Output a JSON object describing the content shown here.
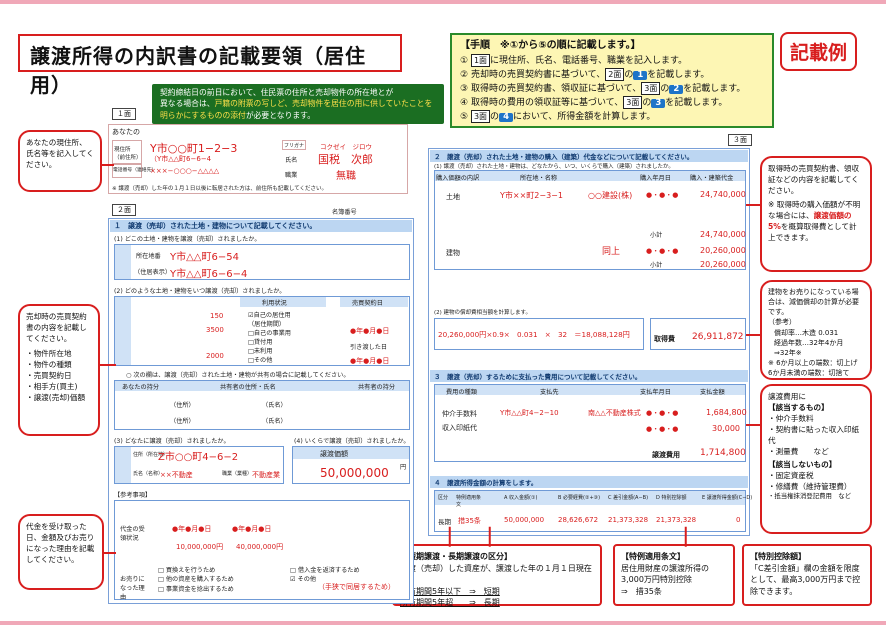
{
  "header": {
    "title": "譲渡所得の内訳書の記載要領（居住用）",
    "example_label": "記載例"
  },
  "steps": {
    "title": "【手順　※①から⑤の順に記載します。】",
    "items": [
      {
        "num": "①",
        "pre": "",
        "page": "1面",
        "post": "に現住所、氏名、電話番号、職業を記入します。"
      },
      {
        "num": "②",
        "pre": "売却時の売買契約書に基づいて、",
        "page": "2面",
        "badge": "1",
        "post": "を記載します。"
      },
      {
        "num": "③",
        "pre": "取得時の売買契約書、領収証に基づいて、",
        "page": "3面",
        "badge": "2",
        "post": "を記載します。"
      },
      {
        "num": "④",
        "pre": "取得時の費用の領収証等に基づいて、",
        "page": "3面",
        "badge": "3",
        "post": "を記載します。"
      },
      {
        "num": "⑤",
        "pre": "",
        "page": "3面",
        "badge": "4",
        "post": "において、所得金額を計算します。"
      }
    ]
  },
  "green_note": {
    "line1": "契約締結日の前日において、住民票の住所と売却物件の所在地とが",
    "line2_pre": "異なる場合は、",
    "line2_red": "戸籍の附票の写しど、売却物件を居住の用に供していたことを明らかにするものの添付",
    "line2_post": "が必要となります。"
  },
  "notes": {
    "address": "あなたの現住所、氏名等を記入してください。",
    "sale_contract": "売却時の売買契約書の内容を記載してください。",
    "sale_items": [
      "物件所在地",
      "物件の種類",
      "売買契約日",
      "相手方(買主)",
      "譲渡(売却)価額"
    ],
    "payment": "代金を受け取った日、金額及びお売りになった理由を記載してください。",
    "purchase": "取得時の売買契約書、領収証などの内容を記載してください。",
    "purchase_warn_pre": "※ 取得時の購入価額が不明な場合には、",
    "purchase_warn_red": "譲渡価額の5%",
    "purchase_warn_post": "を概算取得費として計上できます。",
    "depreciation": "建物をお売りになっている場合は、減価償却の計算が必要です。",
    "depreciation_ref": "（参考）",
    "depreciation_rates": [
      "償却率…木造 0.031",
      "経過年数…32年4か月",
      "⇒32年※"
    ],
    "depreciation_footnote": "※ 6か月以上の端数：切上げ 6か月未満の端数：切捨て",
    "expense_title": "譲渡費用に",
    "expense_in_title": "【該当するもの】",
    "expense_in": [
      "仲介手数料",
      "契約書に貼った収入印紙代",
      "測量費　　など"
    ],
    "expense_out_title": "【該当しないもの】",
    "expense_out": [
      "固定資産税",
      "修繕費（維持管理費）",
      "抵当権抹消登記費用　など"
    ]
  },
  "bottom_notes": {
    "period": {
      "title": "【短期譲渡・長期譲渡の区分】",
      "body": "譲渡（売却）した資産が、譲渡した年の１月１日現在で",
      "short": "所有期間5年以下　⇒　短期",
      "long": "所有期間5年超　　⇒　長期"
    },
    "special": {
      "title": "【特例適用条文】",
      "body": "居住用財産の譲渡所得の3,000万円特別控除",
      "ref": "⇒　措35条"
    },
    "deduction": {
      "title": "【特別控除額】",
      "body": "「C差引金額」欄の金額を限度として、最高3,000万円まで控除できます。"
    }
  },
  "page1": {
    "page_no": "１面",
    "you_label": "あなたの",
    "address_label": "現住所（前住所）",
    "address": "Y市○○町1−2−3",
    "prev_address": "（Y市△△町6−6−4",
    "phone_label": "電話番号（連絡先）",
    "phone": "×××−○○○−△△△△",
    "furigana_label": "フリガナ",
    "furigana": "コクゼイ　ジロウ",
    "name_label": "氏名",
    "name": "国税　次郎",
    "job_label": "職業",
    "job": "無職",
    "footnote": "※ 譲渡（売却）した年の１月１日以後に転居された方は、前住所も記載してください。"
  },
  "page2": {
    "page_no": "２面",
    "ref_label": "名簿番号",
    "sec1": "１　譲渡（売却）された土地・建物について記載してください。",
    "q1": "(1) どこの土地・建物を譲渡（売却）されましたか。",
    "location_label": "所在地番",
    "location": "Y市△△町6−54",
    "residence_label": "（住居表示）",
    "residence": "Y市△△町6−6−4",
    "q2": "(2) どのような土地・建物をいつ譲渡（売却）されましたか。",
    "use_label": "利用状況",
    "contract_label": "売買契約日",
    "delivery_label": "引き渡した日",
    "land_area": "150",
    "bldg_area": "3500",
    "bldg_area2": "2000",
    "use_items": [
      "自己の居住用",
      "（居住期間）",
      "自己の事業用",
      "貸付用",
      "未利用",
      "その他"
    ],
    "date_marks": "●年●月●日",
    "q2_note": "○ 次の欄は、譲渡（売却）された土地・建物が共有の場合に記載してください。",
    "owner_label": "あなたの持分",
    "co_owner_label": "共有者の住所・氏名",
    "co_share_label": "共有者の持分",
    "addr_label": "（住所）",
    "nm_label": "（氏名）",
    "q3": "(3) どなたに譲渡（売却）されましたか。",
    "buyer_addr_label": "住所（所在地）",
    "buyer_addr": "Z市○○町4−6−2",
    "buyer_name_label": "氏名（名称）",
    "buyer_name": "××不動産",
    "buyer_job_label": "職業（業種）",
    "buyer_job": "不動産業",
    "q4": "(4) いくらで譲渡（売却）されましたか。",
    "price_label": "譲渡価額",
    "price": "50,000,000",
    "yen": "円",
    "ref_item": "【参考事項】",
    "payment_label": "代金の受領状況",
    "pay1_date": "●年●月●日",
    "pay1_amount": "10,000,000円",
    "pay2_date": "●年●月●日",
    "pay2_amount": "40,000,000円",
    "reason_label": "お売りになった理由",
    "reasons": [
      "□ 買換えを行うため",
      "□ 借入金を返済するため",
      "□ 他の資産を購入するため",
      "□ 事業資金を捻出するため",
      "□ 住宅ローンを…",
      "☑ その他"
    ],
    "reason_other": "（手狭で同居するため）"
  },
  "page3": {
    "page_no": "３面",
    "sec2": "２　譲渡（売却）された土地・建物の購入（建築）代金などについて記載してください。",
    "sec2_sub": "(1) 譲渡（売却）された土地・建物は、どなたから、いつ、いくらで購入（建築）されましたか。",
    "cols": [
      "購入価額の内訳",
      "所在地・名称",
      "購入年月日",
      "購入・建築代金"
    ],
    "land_label": "土地",
    "land_seller_addr": "Y市××町2−3−1",
    "land_seller": "○○建設(株)",
    "land_price": "24,740,000",
    "land_subtotal": "24,740,000",
    "bldg_label": "建物",
    "bldg_seller": "同上",
    "bldg_price": "20,260,000",
    "bldg_subtotal": "20,260,000",
    "subtotal_label": "小計",
    "date_marks": "●・●・●",
    "bldg_calc_label": "(2) 建物の償却費相当額を計算します。",
    "bldg_calc": "20,260,000円×0.9×　0.031　×　32　＝18,088,128円",
    "cost_label": "取得費",
    "cost": "26,911,872",
    "sec3": "３　譲渡（売却）するために支払った費用について記載してください。",
    "exp_cols": [
      "費用の種類",
      "支払先",
      "支払年月日",
      "支払金額"
    ],
    "exp1_type": "仲介手数料",
    "exp1_payee": "Y市△△町4−2−10",
    "exp1_payee_name": "南△△不動産株式",
    "exp1_amount": "1,684,800",
    "exp2_type": "収入印紙代",
    "exp2_amount": "30,000",
    "expense_label": "譲渡費用",
    "expense_total": "1,714,800",
    "sec4": "４　譲渡所得金額の計算をします。",
    "calc_cols": [
      "区分",
      "特例適用条文",
      "A 収入金額(①)",
      "B 必要経費(②+③)",
      "C 差引金額(A−B)",
      "D 特別控除額",
      "E 譲渡所得金額(C−D)"
    ],
    "calc_kubun": "長期",
    "calc_article": "措35条",
    "calc_A": "50,000,000",
    "calc_B": "28,626,672",
    "calc_C": "21,373,328",
    "calc_D": "21,373,328",
    "calc_E": "0"
  }
}
